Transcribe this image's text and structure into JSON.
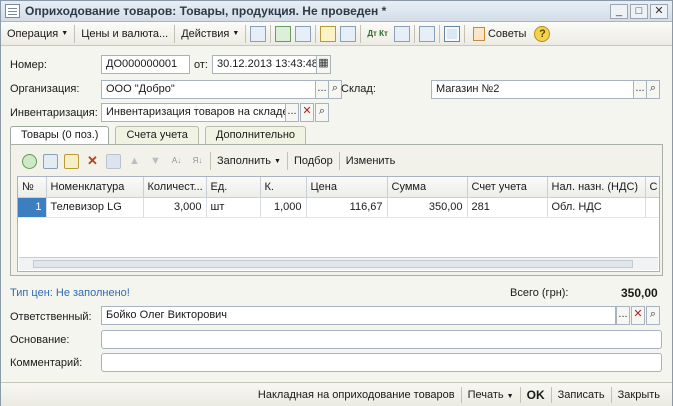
{
  "window": {
    "title": "Оприходование товаров: Товары, продукция. Не проведен *",
    "minimize": "_",
    "maximize": "□",
    "close": "✕"
  },
  "toolbar": {
    "operation": "Операция",
    "prices": "Цены и валюта...",
    "actions": "Действия",
    "tips": "Советы",
    "help": "?",
    "dtkt": "Дт Кт"
  },
  "form": {
    "number_label": "Номер:",
    "number_value": "ДО000000001",
    "date_label": "от:",
    "date_value": "30.12.2013 13:43:48",
    "org_label": "Организация:",
    "org_value": "ООО \"Добро\"",
    "warehouse_label": "Склад:",
    "warehouse_value": "Магазин №2",
    "inventory_label": "Инвентаризация:",
    "inventory_value": "Инвентаризация товаров на складе",
    "ellipsis": "...",
    "clear": "✕",
    "search": "⌕"
  },
  "tabs": [
    {
      "label": "Товары (0 поз.)"
    },
    {
      "label": "Счета учета"
    },
    {
      "label": "Дополнительно"
    }
  ],
  "table_toolbar": {
    "fill": "Заполнить",
    "select": "Подбор",
    "change": "Изменить"
  },
  "table": {
    "columns": [
      "№",
      "Номенклатура",
      "Количест...",
      "Ед.",
      "К.",
      "Цена",
      "Сумма",
      "Счет учета",
      "Нал. назн. (НДС)",
      "С"
    ],
    "rows": [
      [
        "1",
        "Телевизор LG",
        "3,000",
        "шт",
        "1,000",
        "116,67",
        "350,00",
        "281",
        "Обл. НДС",
        ""
      ]
    ]
  },
  "summary": {
    "price_type": "Тип цен: Не заполнено!",
    "total_label": "Всего (грн):",
    "total_value": "350,00"
  },
  "bottom": {
    "responsible_label": "Ответственный:",
    "responsible_value": "Бойко Олег Викторович",
    "basis_label": "Основание:",
    "basis_value": "",
    "comment_label": "Комментарий:",
    "comment_value": ""
  },
  "footer": {
    "invoice": "Накладная на оприходование товаров",
    "print": "Печать",
    "ok": "OK",
    "save": "Записать",
    "close": "Закрыть"
  }
}
